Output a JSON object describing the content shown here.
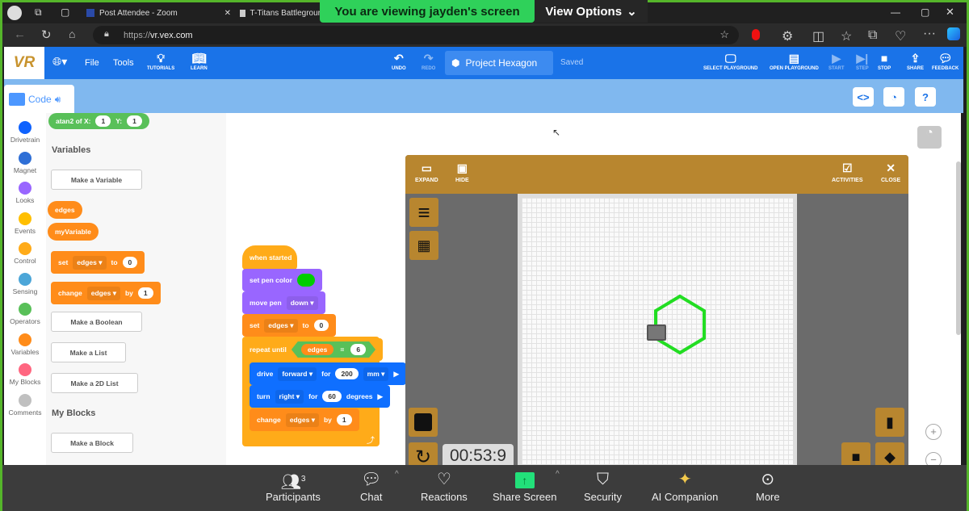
{
  "browser": {
    "tabs": [
      {
        "label": "Post Attendee - Zoom"
      },
      {
        "label": "T-Titans Battlegrour"
      }
    ],
    "url_prefix": "https://",
    "url_host": "vr.vex.com"
  },
  "zoom_banner": {
    "viewing": "You are viewing  jayden's screen",
    "view_options": "View Options"
  },
  "vex_toolbar": {
    "logo": "VR",
    "file": "File",
    "tools": "Tools",
    "tutorials": "TUTORIALS",
    "learn": "LEARN",
    "undo": "UNDO",
    "redo": "REDO",
    "project_name": "Project Hexagon",
    "status": "Saved",
    "select_playground": "SELECT PLAYGROUND",
    "open_playground": "OPEN PLAYGROUND",
    "start": "START",
    "step": "STEP",
    "stop": "STOP",
    "share": "SHARE",
    "feedback": "FEEDBACK"
  },
  "code_tab": {
    "label": "Code"
  },
  "categories": [
    {
      "label": "Drivetrain",
      "color": "#0f62fe"
    },
    {
      "label": "Magnet",
      "color": "#2f6fd6"
    },
    {
      "label": "Looks",
      "color": "#9966ff"
    },
    {
      "label": "Events",
      "color": "#ffbf00"
    },
    {
      "label": "Control",
      "color": "#ffab19"
    },
    {
      "label": "Sensing",
      "color": "#4ca6d8"
    },
    {
      "label": "Operators",
      "color": "#59c059"
    },
    {
      "label": "Variables",
      "color": "#ff8c1a"
    },
    {
      "label": "My Blocks",
      "color": "#ff6680"
    },
    {
      "label": "Comments",
      "color": "#c0c0c0"
    }
  ],
  "palette": {
    "atan2": {
      "label": "atan2 of X:",
      "x": "1",
      "ylabel": "Y:",
      "y": "1"
    },
    "variables_heading": "Variables",
    "make_variable": "Make a Variable",
    "var1": "edges",
    "var2": "myVariable",
    "set_block": {
      "set": "set",
      "var": "edges",
      "to": "to",
      "value": "0"
    },
    "change_block": {
      "change": "change",
      "var": "edges",
      "by": "by",
      "value": "1"
    },
    "make_boolean": "Make a Boolean",
    "make_list": "Make a List",
    "make_2d_list": "Make a 2D List",
    "myblocks_heading": "My Blocks",
    "make_block": "Make a Block"
  },
  "script": {
    "when_started": "when started",
    "set_pen_color": "set pen color",
    "pen_color": "#00cc00",
    "move_pen": "move pen",
    "pen_state": "down",
    "set": "set",
    "set_var": "edges",
    "to": "to",
    "set_val": "0",
    "repeat_until": "repeat until",
    "cond_var": "edges",
    "cond_op": "=",
    "cond_val": "6",
    "drive": "drive",
    "drive_dir": "forward",
    "for": "for",
    "drive_val": "200",
    "drive_unit": "mm",
    "turn": "turn",
    "turn_dir": "right",
    "turn_val": "60",
    "turn_unit": "degrees",
    "change": "change",
    "change_var": "edges",
    "by": "by",
    "change_val": "1"
  },
  "playground": {
    "expand": "EXPAND",
    "hide": "HIDE",
    "activities": "ACTIVITIES",
    "close": "CLOSE",
    "timer": "00:53:9",
    "trail_color": "#22dd22"
  },
  "zoom_toolbar": {
    "participants": "Participants",
    "participants_count": "3",
    "chat": "Chat",
    "reactions": "Reactions",
    "share_screen": "Share Screen",
    "security": "Security",
    "ai_companion": "AI Companion",
    "more": "More"
  }
}
